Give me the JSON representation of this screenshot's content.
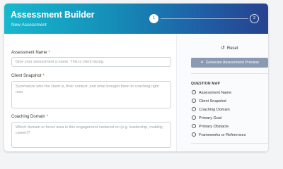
{
  "header": {
    "title": "Assessment Builder",
    "subtitle": "New Assessment",
    "steps": [
      "1",
      "2"
    ]
  },
  "form": {
    "assessment_name": {
      "label": "Assessment Name",
      "placeholder": "Give your assessment a name. This is client facing."
    },
    "client_snapshot": {
      "label": "Client Snapshot",
      "placeholder": "Summarize who the client is, their context, and what brought them to coaching right now."
    },
    "coaching_domain": {
      "label": "Coaching Domain",
      "placeholder": "Which domain or focus area is this engagement centered on (e.g. leadership, mobility, career)?"
    },
    "required_mark": "*"
  },
  "sidebar": {
    "reset_label": "Reset",
    "generate_label": "Generate Assessment Preview",
    "question_map_title": "QUESTION MAP",
    "question_map_items": [
      "Assessment Name",
      "Client Snapshot",
      "Coaching Domain",
      "Primary Goal",
      "Primary Obstacle",
      "Frameworks or References"
    ]
  }
}
